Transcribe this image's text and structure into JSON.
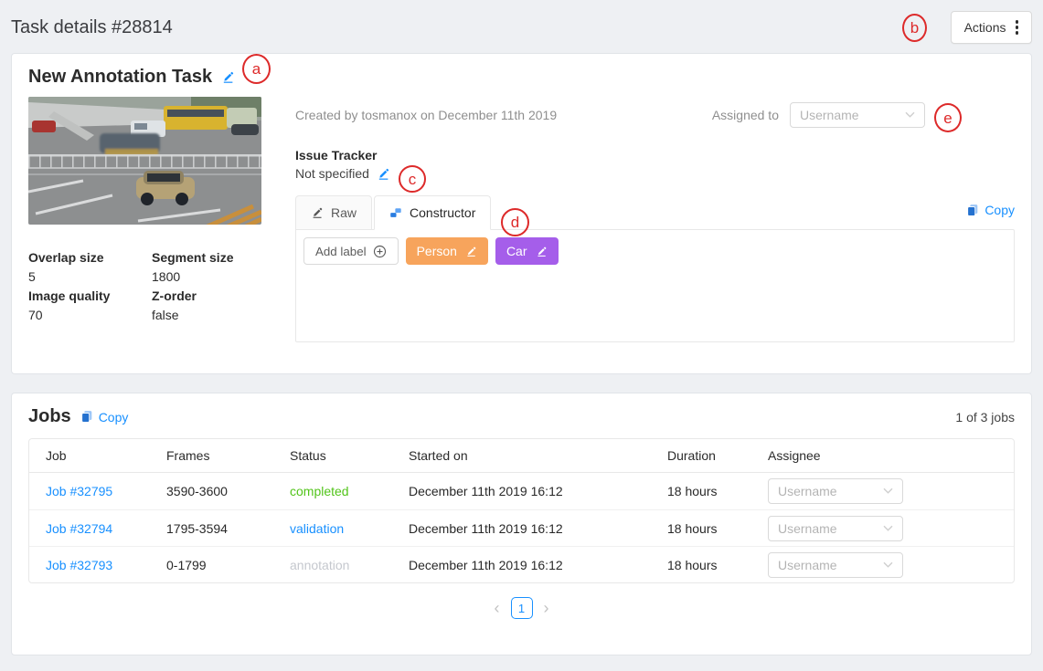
{
  "page": {
    "title": "Task details #28814"
  },
  "header": {
    "actions_label": "Actions"
  },
  "overlay": {
    "a": "a",
    "b": "b",
    "c": "c",
    "d": "d",
    "e": "e"
  },
  "task": {
    "name": "New Annotation Task",
    "created_line": "Created by tosmanox on December 11th 2019",
    "assigned_to_label": "Assigned to",
    "assignee_placeholder": "Username",
    "issue_tracker": {
      "label": "Issue Tracker",
      "value": "Not specified"
    },
    "params": [
      {
        "label": "Overlap size",
        "value": "5"
      },
      {
        "label": "Segment size",
        "value": "1800"
      },
      {
        "label": "Image quality",
        "value": "70"
      },
      {
        "label": "Z-order",
        "value": "false"
      }
    ],
    "tabs": {
      "raw": "Raw",
      "constructor": "Constructor"
    },
    "copy_label": "Copy",
    "add_label_button": "Add label",
    "labels": [
      {
        "name": "Person",
        "color": "#f7a45c"
      },
      {
        "name": "Car",
        "color": "#a55eea"
      }
    ]
  },
  "jobs": {
    "title": "Jobs",
    "copy_label": "Copy",
    "count_text": "1 of 3 jobs",
    "columns": [
      "Job",
      "Frames",
      "Status",
      "Started on",
      "Duration",
      "Assignee"
    ],
    "rows": [
      {
        "job": "Job #32795",
        "frames": "3590-3600",
        "status": "completed",
        "status_color": "#52c41a",
        "started": "December 11th 2019 16:12",
        "duration": "18 hours",
        "assignee_placeholder": "Username"
      },
      {
        "job": "Job #32794",
        "frames": "1795-3594",
        "status": "validation",
        "status_color": "#1890ff",
        "started": "December 11th 2019 16:12",
        "duration": "18 hours",
        "assignee_placeholder": "Username"
      },
      {
        "job": "Job #32793",
        "frames": "0-1799",
        "status": "annotation",
        "status_color": "#c5c8ce",
        "started": "December 11th 2019 16:12",
        "duration": "18 hours",
        "assignee_placeholder": "Username"
      }
    ],
    "pagination": {
      "prev": "‹",
      "current": "1",
      "next": "›"
    }
  },
  "colors": {
    "accent": "#1890ff",
    "status_completed": "#52c41a",
    "status_validation": "#1890ff",
    "status_annotation": "#c5c8ce"
  }
}
